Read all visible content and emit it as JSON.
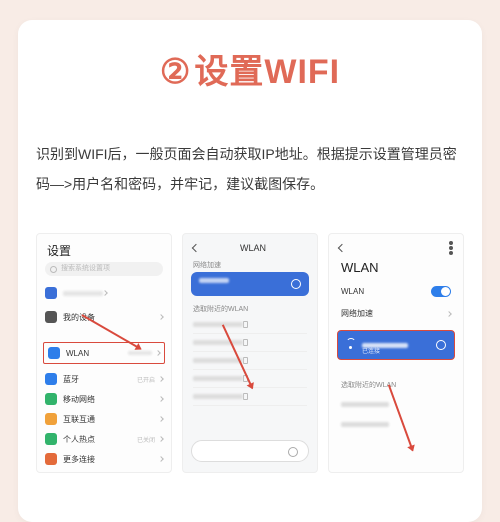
{
  "title": {
    "number": "②",
    "text": "设置WIFI"
  },
  "description": "识别到WIFI后，一般页面会自动获取IP地址。根据提示设置管理员密码—>用户名和密码，并牢记，建议截图保存。",
  "phone1": {
    "settings_title": "设置",
    "search_placeholder": "搜索系统设置项",
    "row_account": "",
    "row_device": "我的设备",
    "row_wlan": "WLAN",
    "row_wlan_sub": "",
    "row_bt": "蓝牙",
    "row_bt_sub": "已开启",
    "row_mobile": "移动网络",
    "row_connect": "互联互通",
    "row_hotspot": "个人热点",
    "row_hotspot_sub": "已关闭",
    "row_more": "更多连接"
  },
  "phone2": {
    "title": "WLAN",
    "section_accel": "网络加速",
    "section_nearby": "选取附近的WLAN"
  },
  "phone3": {
    "title": "WLAN",
    "row_wlan": "WLAN",
    "row_accel": "网络加速",
    "connected_sub": "已连接",
    "section_nearby": "选取附近的WLAN"
  }
}
